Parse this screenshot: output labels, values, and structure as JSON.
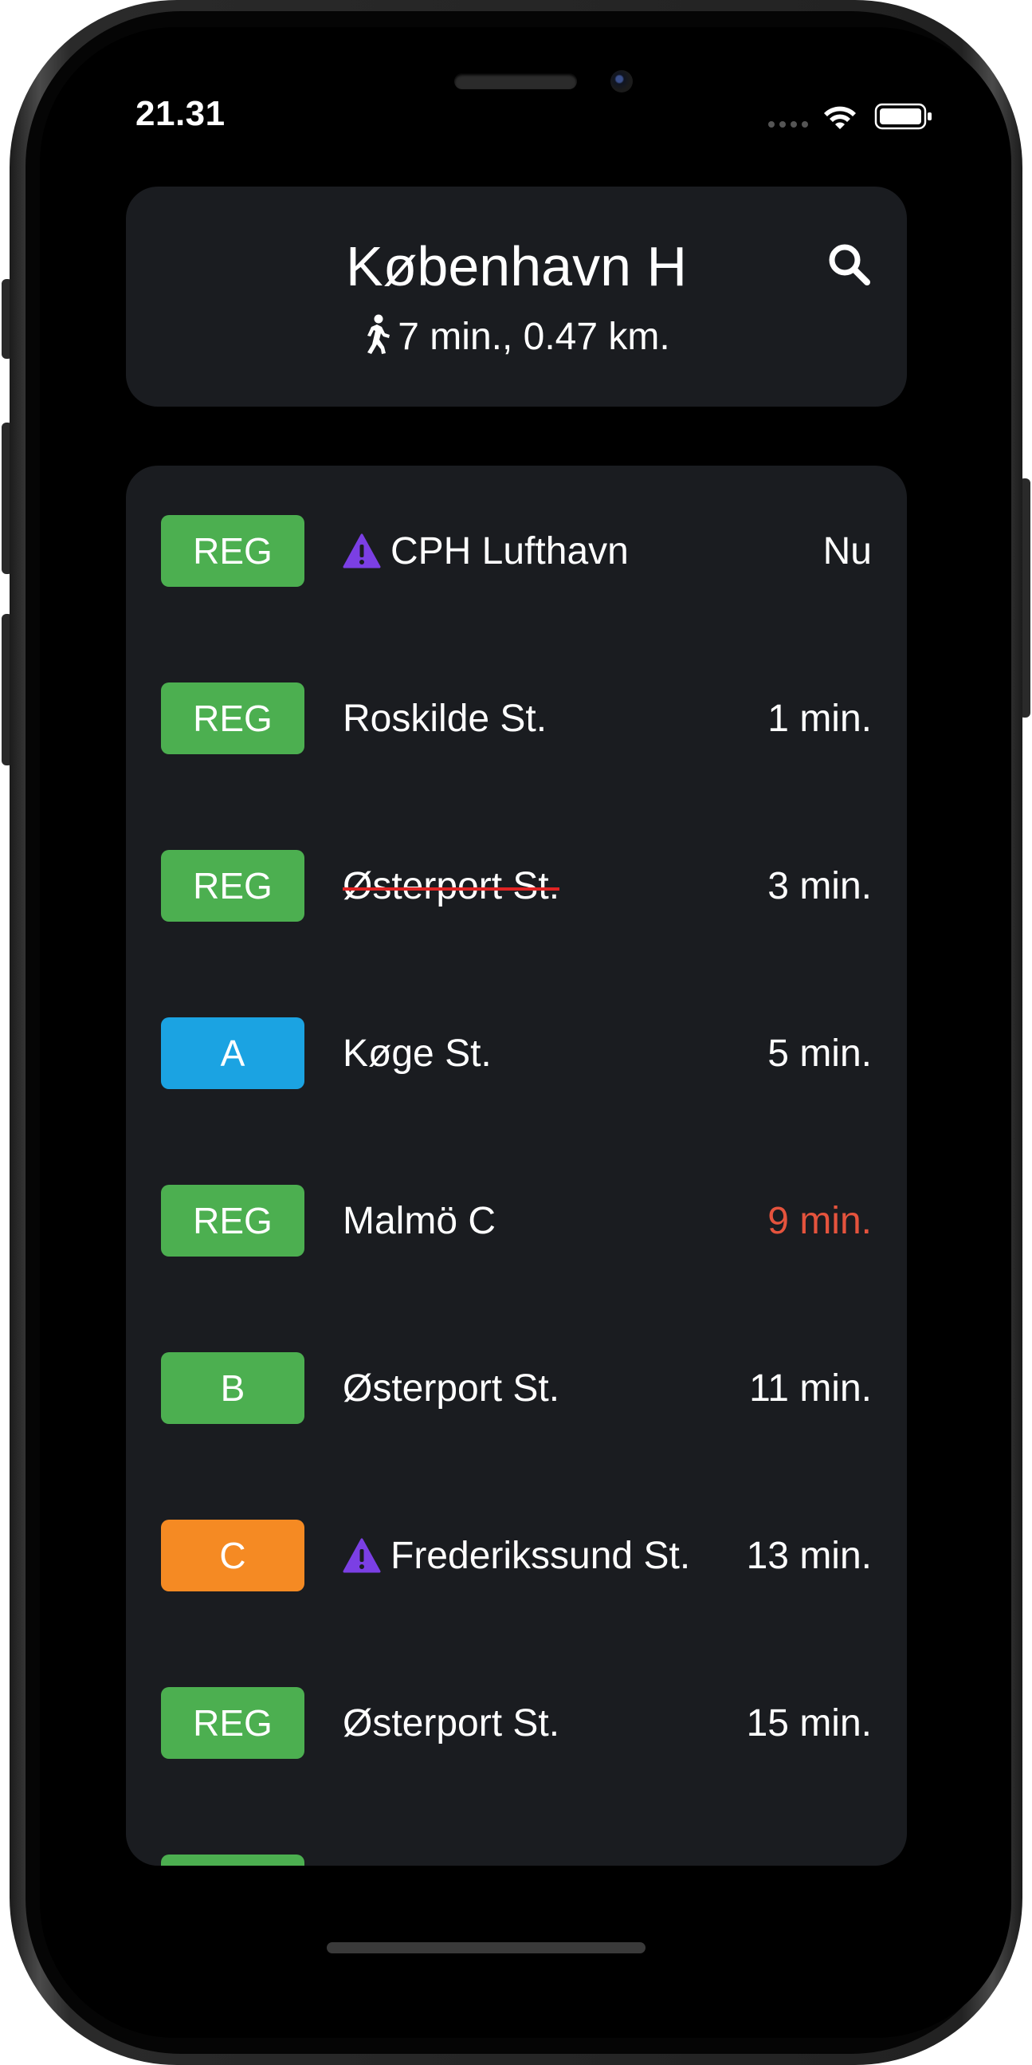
{
  "status_bar": {
    "time": "21.31"
  },
  "header": {
    "station": "København H",
    "walk_info": "7 min., 0.47 km."
  },
  "departures": [
    {
      "line": "REG",
      "line_color": "#4caf50",
      "destination": "CPH Lufthavn",
      "eta": "Nu",
      "warning": true,
      "cancelled": false,
      "delayed": false
    },
    {
      "line": "REG",
      "line_color": "#4caf50",
      "destination": "Roskilde St.",
      "eta": "1 min.",
      "warning": false,
      "cancelled": false,
      "delayed": false
    },
    {
      "line": "REG",
      "line_color": "#4caf50",
      "destination": "Østerport St.",
      "eta": "3 min.",
      "warning": false,
      "cancelled": true,
      "delayed": false
    },
    {
      "line": "A",
      "line_color": "#1ba3e2",
      "destination": "Køge St.",
      "eta": "5 min.",
      "warning": false,
      "cancelled": false,
      "delayed": false
    },
    {
      "line": "REG",
      "line_color": "#4caf50",
      "destination": "Malmö C",
      "eta": "9 min.",
      "warning": false,
      "cancelled": false,
      "delayed": true
    },
    {
      "line": "B",
      "line_color": "#4caf50",
      "destination": "Østerport St.",
      "eta": "11 min.",
      "warning": false,
      "cancelled": false,
      "delayed": false
    },
    {
      "line": "C",
      "line_color": "#f58a23",
      "destination": "Frederikssund St.",
      "eta": "13 min.",
      "warning": true,
      "cancelled": false,
      "delayed": false
    },
    {
      "line": "REG",
      "line_color": "#4caf50",
      "destination": "Østerport St.",
      "eta": "15 min.",
      "warning": false,
      "cancelled": false,
      "delayed": false
    },
    {
      "line": "",
      "line_color": "#4caf50",
      "destination": "",
      "eta": "",
      "warning": false,
      "cancelled": false,
      "delayed": false
    }
  ],
  "colors": {
    "delayed": "#e5533d",
    "warning_icon": "#7b3fe4",
    "card_background": "#1a1c20"
  },
  "icons": {
    "search": "search-icon",
    "walk": "walking-person-icon",
    "warning": "warning-triangle-icon",
    "wifi": "wifi-icon",
    "battery": "battery-icon",
    "signal": "signal-icon"
  }
}
